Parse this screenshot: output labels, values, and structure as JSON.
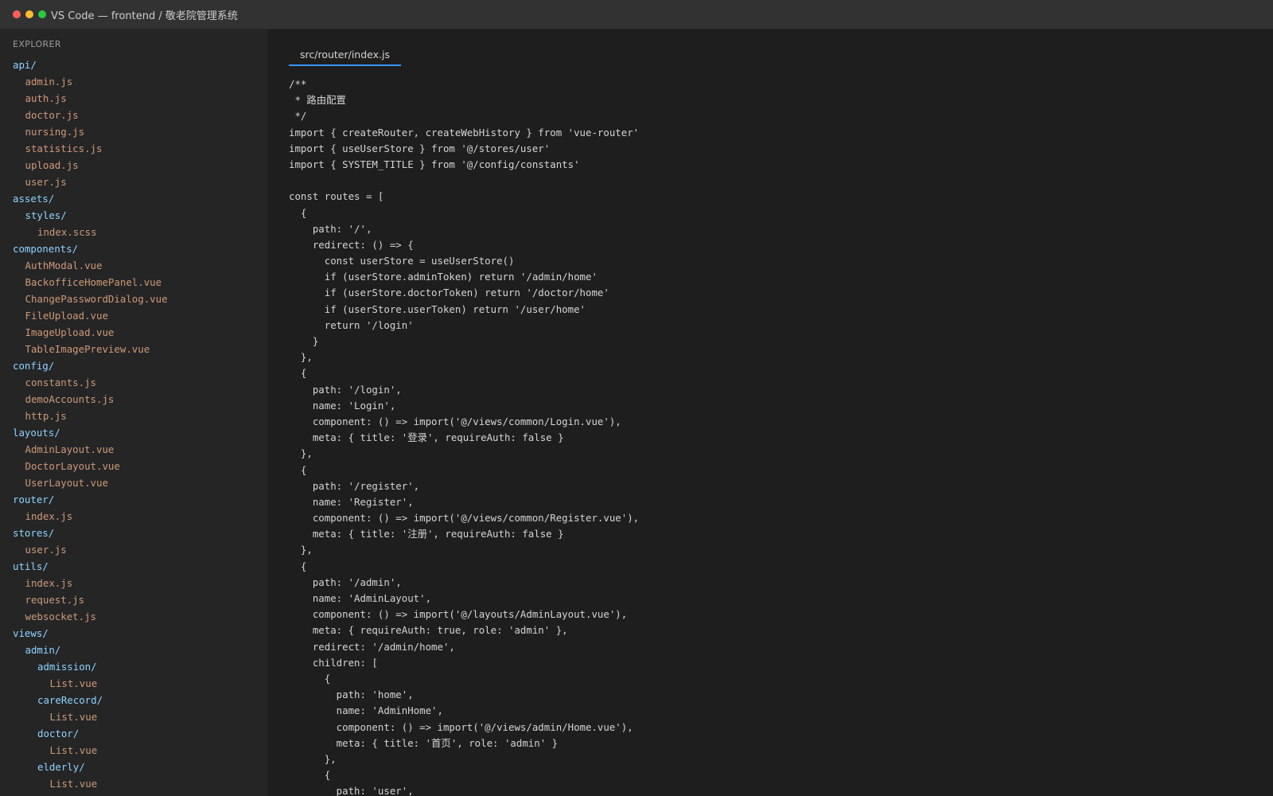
{
  "window": {
    "title": "VS Code — frontend / 敬老院管理系统"
  },
  "sidebar": {
    "header": "EXPLORER",
    "items": [
      {
        "label": "api/",
        "kind": "folder",
        "depth": 0
      },
      {
        "label": "admin.js",
        "kind": "file",
        "depth": 1
      },
      {
        "label": "auth.js",
        "kind": "file",
        "depth": 1
      },
      {
        "label": "doctor.js",
        "kind": "file",
        "depth": 1
      },
      {
        "label": "nursing.js",
        "kind": "file",
        "depth": 1
      },
      {
        "label": "statistics.js",
        "kind": "file",
        "depth": 1
      },
      {
        "label": "upload.js",
        "kind": "file",
        "depth": 1
      },
      {
        "label": "user.js",
        "kind": "file",
        "depth": 1
      },
      {
        "label": "assets/",
        "kind": "folder",
        "depth": 0
      },
      {
        "label": "styles/",
        "kind": "folder",
        "depth": 1
      },
      {
        "label": "index.scss",
        "kind": "file",
        "depth": 2
      },
      {
        "label": "components/",
        "kind": "folder",
        "depth": 0
      },
      {
        "label": "AuthModal.vue",
        "kind": "file",
        "depth": 1
      },
      {
        "label": "BackofficeHomePanel.vue",
        "kind": "file",
        "depth": 1
      },
      {
        "label": "ChangePasswordDialog.vue",
        "kind": "file",
        "depth": 1
      },
      {
        "label": "FileUpload.vue",
        "kind": "file",
        "depth": 1
      },
      {
        "label": "ImageUpload.vue",
        "kind": "file",
        "depth": 1
      },
      {
        "label": "TableImagePreview.vue",
        "kind": "file",
        "depth": 1
      },
      {
        "label": "config/",
        "kind": "folder",
        "depth": 0
      },
      {
        "label": "constants.js",
        "kind": "file",
        "depth": 1
      },
      {
        "label": "demoAccounts.js",
        "kind": "file",
        "depth": 1
      },
      {
        "label": "http.js",
        "kind": "file",
        "depth": 1
      },
      {
        "label": "layouts/",
        "kind": "folder",
        "depth": 0
      },
      {
        "label": "AdminLayout.vue",
        "kind": "file",
        "depth": 1
      },
      {
        "label": "DoctorLayout.vue",
        "kind": "file",
        "depth": 1
      },
      {
        "label": "UserLayout.vue",
        "kind": "file",
        "depth": 1
      },
      {
        "label": "router/",
        "kind": "folder",
        "depth": 0
      },
      {
        "label": "index.js",
        "kind": "file",
        "depth": 1
      },
      {
        "label": "stores/",
        "kind": "folder",
        "depth": 0
      },
      {
        "label": "user.js",
        "kind": "file",
        "depth": 1
      },
      {
        "label": "utils/",
        "kind": "folder",
        "depth": 0
      },
      {
        "label": "index.js",
        "kind": "file",
        "depth": 1
      },
      {
        "label": "request.js",
        "kind": "file",
        "depth": 1
      },
      {
        "label": "websocket.js",
        "kind": "file",
        "depth": 1
      },
      {
        "label": "views/",
        "kind": "folder",
        "depth": 0
      },
      {
        "label": "admin/",
        "kind": "folder",
        "depth": 1
      },
      {
        "label": "admission/",
        "kind": "folder",
        "depth": 2
      },
      {
        "label": "List.vue",
        "kind": "file",
        "depth": 3
      },
      {
        "label": "careRecord/",
        "kind": "folder",
        "depth": 2
      },
      {
        "label": "List.vue",
        "kind": "file",
        "depth": 3
      },
      {
        "label": "doctor/",
        "kind": "folder",
        "depth": 2
      },
      {
        "label": "List.vue",
        "kind": "file",
        "depth": 3
      },
      {
        "label": "elderly/",
        "kind": "folder",
        "depth": 2
      },
      {
        "label": "List.vue",
        "kind": "file",
        "depth": 3
      }
    ]
  },
  "editor": {
    "tab_label": "src/router/index.js",
    "lines": [
      "/**",
      " * 路由配置",
      " */",
      "import { createRouter, createWebHistory } from 'vue-router'",
      "import { useUserStore } from '@/stores/user'",
      "import { SYSTEM_TITLE } from '@/config/constants'",
      "",
      "const routes = [",
      "  {",
      "    path: '/',",
      "    redirect: () => {",
      "      const userStore = useUserStore()",
      "      if (userStore.adminToken) return '/admin/home'",
      "      if (userStore.doctorToken) return '/doctor/home'",
      "      if (userStore.userToken) return '/user/home'",
      "      return '/login'",
      "    }",
      "  },",
      "  {",
      "    path: '/login',",
      "    name: 'Login',",
      "    component: () => import('@/views/common/Login.vue'),",
      "    meta: { title: '登录', requireAuth: false }",
      "  },",
      "  {",
      "    path: '/register',",
      "    name: 'Register',",
      "    component: () => import('@/views/common/Register.vue'),",
      "    meta: { title: '注册', requireAuth: false }",
      "  },",
      "  {",
      "    path: '/admin',",
      "    name: 'AdminLayout',",
      "    component: () => import('@/layouts/AdminLayout.vue'),",
      "    meta: { requireAuth: true, role: 'admin' },",
      "    redirect: '/admin/home',",
      "    children: [",
      "      {",
      "        path: 'home',",
      "        name: 'AdminHome',",
      "        component: () => import('@/views/admin/Home.vue'),",
      "        meta: { title: '首页', role: 'admin' }",
      "      },",
      "      {",
      "        path: 'user',"
    ]
  }
}
